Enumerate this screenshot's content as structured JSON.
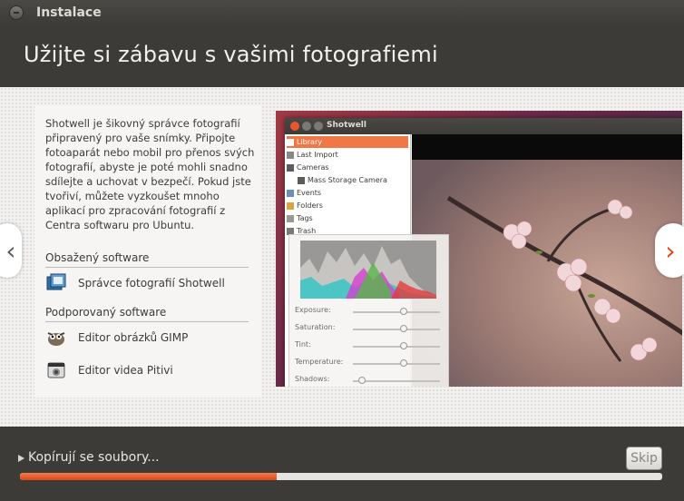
{
  "window": {
    "title": "Instalace"
  },
  "header": {
    "title": "Užijte si zábavu s vašimi fotografiemi"
  },
  "description": "Shotwell je šikovný správce fotografií připravený pro vaše snímky. Připojte fotoaparát nebo mobil pro přenos svých fotografií, abyste je poté mohli snadno sdílejte a uchovat v bezpečí. Pokud jste tvořiví, můžete vyzkoušet mnoho aplikací pro zpracování fotografií z Centra softwaru pro Ubuntu.",
  "included": {
    "heading": "Obsažený software",
    "items": [
      {
        "label": "Správce fotografií Shotwell",
        "icon": "shotwell-icon"
      }
    ]
  },
  "supported": {
    "heading": "Podporovaný software",
    "items": [
      {
        "label": "Editor obrázků GIMP",
        "icon": "gimp-icon"
      },
      {
        "label": "Editor videa Pitivi",
        "icon": "pitivi-icon"
      }
    ]
  },
  "nav": {
    "prev": "‹",
    "next": "›"
  },
  "screenshot": {
    "app_title": "Shotwell",
    "sidebar": [
      "Library",
      "Last Import",
      "Cameras",
      "Mass Storage Camera",
      "Events",
      "Folders",
      "Tags",
      "Trash"
    ],
    "sliders": [
      {
        "label": "Exposure:",
        "value": 0.5
      },
      {
        "label": "Saturation:",
        "value": 0.5
      },
      {
        "label": "Tint:",
        "value": 0.5
      },
      {
        "label": "Temperature:",
        "value": 0.5
      },
      {
        "label": "Shadows:",
        "value": 0.05
      }
    ]
  },
  "footer": {
    "status": "Kopírují se soubory...",
    "skip_label": "Skip",
    "progress": 0.4
  },
  "colors": {
    "accent": "#dd4814",
    "background": "#3c3b37"
  }
}
